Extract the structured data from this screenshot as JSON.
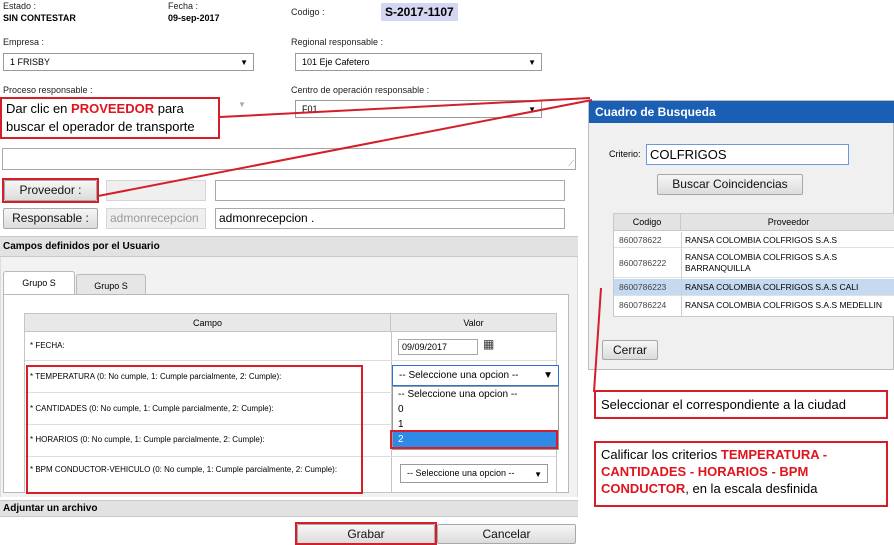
{
  "header": {
    "estado_label": "Estado :",
    "estado_value": "SIN CONTESTAR",
    "fecha_label": "Fecha :",
    "fecha_value": "09-sep-2017",
    "codigo_label": "Codigo :",
    "codigo_value": "S-2017-1107"
  },
  "form": {
    "empresa_label": "Empresa :",
    "empresa_value": "1 FRISBY",
    "regional_label": "Regional responsable :",
    "regional_value": "101 Eje Cafetero",
    "proceso_label": "Proceso responsable :",
    "centro_label": "Centro de operación responsable :",
    "centro_value": "F01",
    "proveedor_button": "Proveedor :",
    "responsable_button": "Responsable :",
    "responsable_code": "admonrecepcion",
    "responsable_name": "admonrecepcion ."
  },
  "callouts": {
    "proveedor_pre": "Dar clic en ",
    "proveedor_hl": "PROVEEDOR",
    "proveedor_post": " para buscar el operador de transporte",
    "ciudad": "Seleccionar el correspondiente a la ciudad",
    "criterios_pre": "Calificar los criterios ",
    "criterios_hl": "TEMPERATURA - CANTIDADES - HORARIOS - BPM CONDUCTOR",
    "criterios_post": ", en la escala desfinida"
  },
  "campos": {
    "section_title": "Campos definidos por el Usuario",
    "tabs": [
      "Grupo S",
      "Grupo S"
    ],
    "col_campo": "Campo",
    "col_valor": "Valor",
    "rows": [
      {
        "label": "* FECHA:",
        "value": "09/09/2017"
      },
      {
        "label": "* TEMPERATURA (0: No cumple, 1: Cumple parcialmente, 2: Cumple):",
        "value": "-- Seleccione una opcion --"
      },
      {
        "label": "* CANTIDADES (0: No cumple, 1: Cumple parcialmente, 2: Cumple):",
        "value": ""
      },
      {
        "label": "* HORARIOS (0: No cumple, 1: Cumple parcialmente, 2: Cumple):",
        "value": ""
      },
      {
        "label": "* BPM CONDUCTOR-VEHICULO (0: No cumple, 1: Cumple parcialmente, 2: Cumple):",
        "value": "-- Seleccione una opcion --"
      }
    ],
    "dropdown_options": [
      "-- Seleccione una opcion --",
      "0",
      "1",
      "2"
    ],
    "dropdown_selected_index": 3
  },
  "adjuntar_title": "Adjuntar un archivo",
  "actions": {
    "grabar": "Grabar",
    "cancelar": "Cancelar"
  },
  "search_dialog": {
    "title": "Cuadro de Busqueda",
    "criterio_label": "Criterio:",
    "criterio_value": "COLFRIGOS",
    "search_button": "Buscar Coincidencias",
    "col_codigo": "Codigo",
    "col_proveedor": "Proveedor",
    "results": [
      {
        "codigo": "860078622",
        "proveedor": "RANSA COLOMBIA COLFRIGOS S.A.S"
      },
      {
        "codigo": "8600786222",
        "proveedor": "RANSA COLOMBIA COLFRIGOS S.A.S BARRANQUILLA"
      },
      {
        "codigo": "8600786223",
        "proveedor": "RANSA COLOMBIA COLFRIGOS S.A.S CALI"
      },
      {
        "codigo": "8600786224",
        "proveedor": "RANSA COLOMBIA COLFRIGOS S.A.S MEDELLIN"
      }
    ],
    "selected_row": 2,
    "close_button": "Cerrar"
  },
  "colors": {
    "annotation_red": "#d41f2a",
    "dialog_title_blue": "#1a5fb4",
    "selection_blue": "#2e8ae6",
    "codigo_highlight": "#d3d7f2"
  }
}
